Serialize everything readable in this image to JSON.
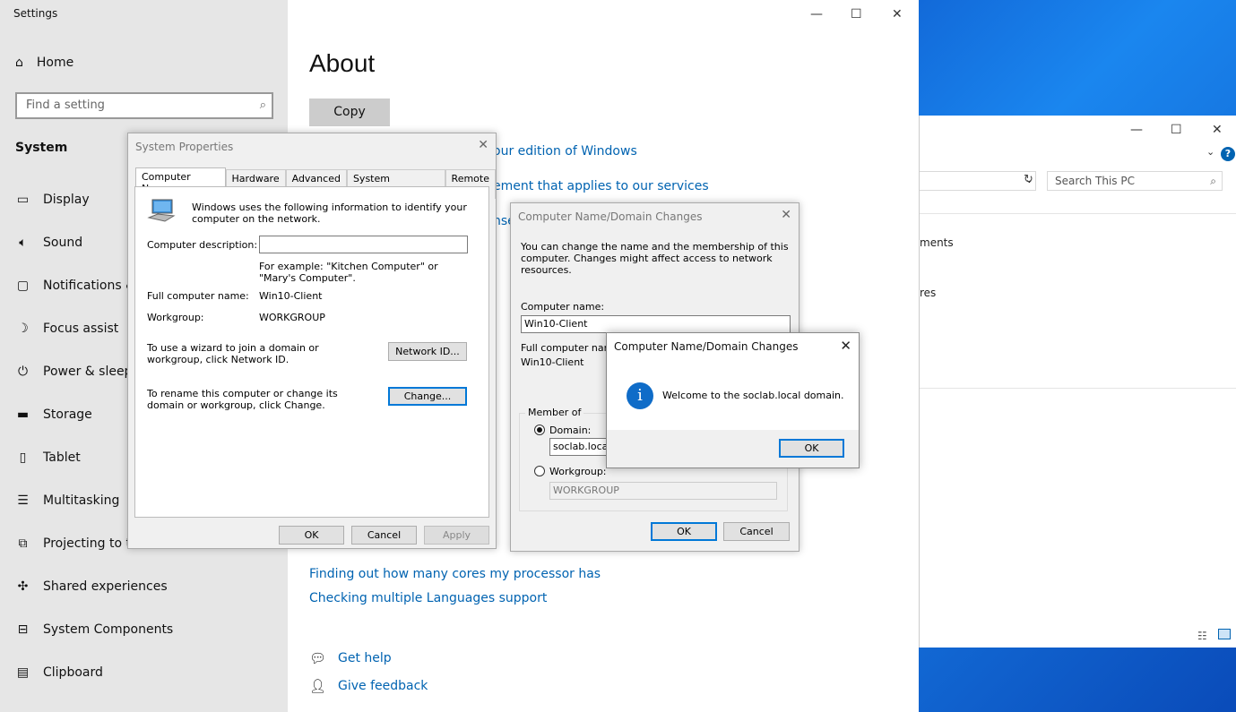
{
  "settings": {
    "window_title": "Settings",
    "home": "Home",
    "search_placeholder": "Find a setting",
    "section": "System",
    "nav": [
      {
        "label": "Display",
        "icon": "monitor-icon"
      },
      {
        "label": "Sound",
        "icon": "speaker-icon"
      },
      {
        "label": "Notifications &",
        "icon": "notification-icon"
      },
      {
        "label": "Focus assist",
        "icon": "moon-icon"
      },
      {
        "label": "Power & sleep",
        "icon": "power-icon"
      },
      {
        "label": "Storage",
        "icon": "storage-icon"
      },
      {
        "label": "Tablet",
        "icon": "tablet-icon"
      },
      {
        "label": "Multitasking",
        "icon": "multitasking-icon"
      },
      {
        "label": "Projecting to th",
        "icon": "projecting-icon"
      },
      {
        "label": "Shared experiences",
        "icon": "shared-icon"
      },
      {
        "label": "System Components",
        "icon": "components-icon"
      },
      {
        "label": "Clipboard",
        "icon": "clipboard-icon"
      }
    ],
    "page_title": "About",
    "copy": "Copy",
    "links": [
      "our edition of Windows",
      "ement that applies to our services",
      "nse"
    ],
    "related": [
      "Finding out how many cores my processor has",
      "Checking multiple Languages support"
    ],
    "get_help": "Get help",
    "give_feedback": "Give feedback"
  },
  "explorer": {
    "search_placeholder": "Search This PC",
    "items": [
      "ments",
      "res"
    ]
  },
  "system_properties": {
    "title": "System Properties",
    "tabs": [
      "Computer Name",
      "Hardware",
      "Advanced",
      "System Protection",
      "Remote"
    ],
    "intro": "Windows uses the following information to identify your computer on the network.",
    "desc_label": "Computer description:",
    "desc_value": "",
    "example": "For example: \"Kitchen Computer\" or \"Mary's Computer\".",
    "full_name_label": "Full computer name:",
    "full_name": "Win10-Client",
    "workgroup_label": "Workgroup:",
    "workgroup": "WORKGROUP",
    "wizard_text": "To use a wizard to join a domain or workgroup, click Network ID.",
    "network_id": "Network ID...",
    "rename_text": "To rename this computer or change its domain or workgroup, click Change.",
    "change": "Change...",
    "ok": "OK",
    "cancel": "Cancel",
    "apply": "Apply"
  },
  "name_changes": {
    "title": "Computer Name/Domain Changes",
    "intro": "You can change the name and the membership of this computer. Changes might affect access to network resources.",
    "name_label": "Computer name:",
    "name_value": "Win10-Client",
    "full_label": "Full computer name:",
    "full_value": "Win10-Client",
    "member_of": "Member of",
    "domain_label": "Domain:",
    "domain_value": "soclab.local",
    "workgroup_label": "Workgroup:",
    "workgroup_value": "WORKGROUP",
    "selected": "Domain",
    "ok": "OK",
    "cancel": "Cancel"
  },
  "welcome": {
    "title": "Computer Name/Domain Changes",
    "message": "Welcome to the soclab.local domain.",
    "ok": "OK",
    "icon": "information-icon"
  }
}
